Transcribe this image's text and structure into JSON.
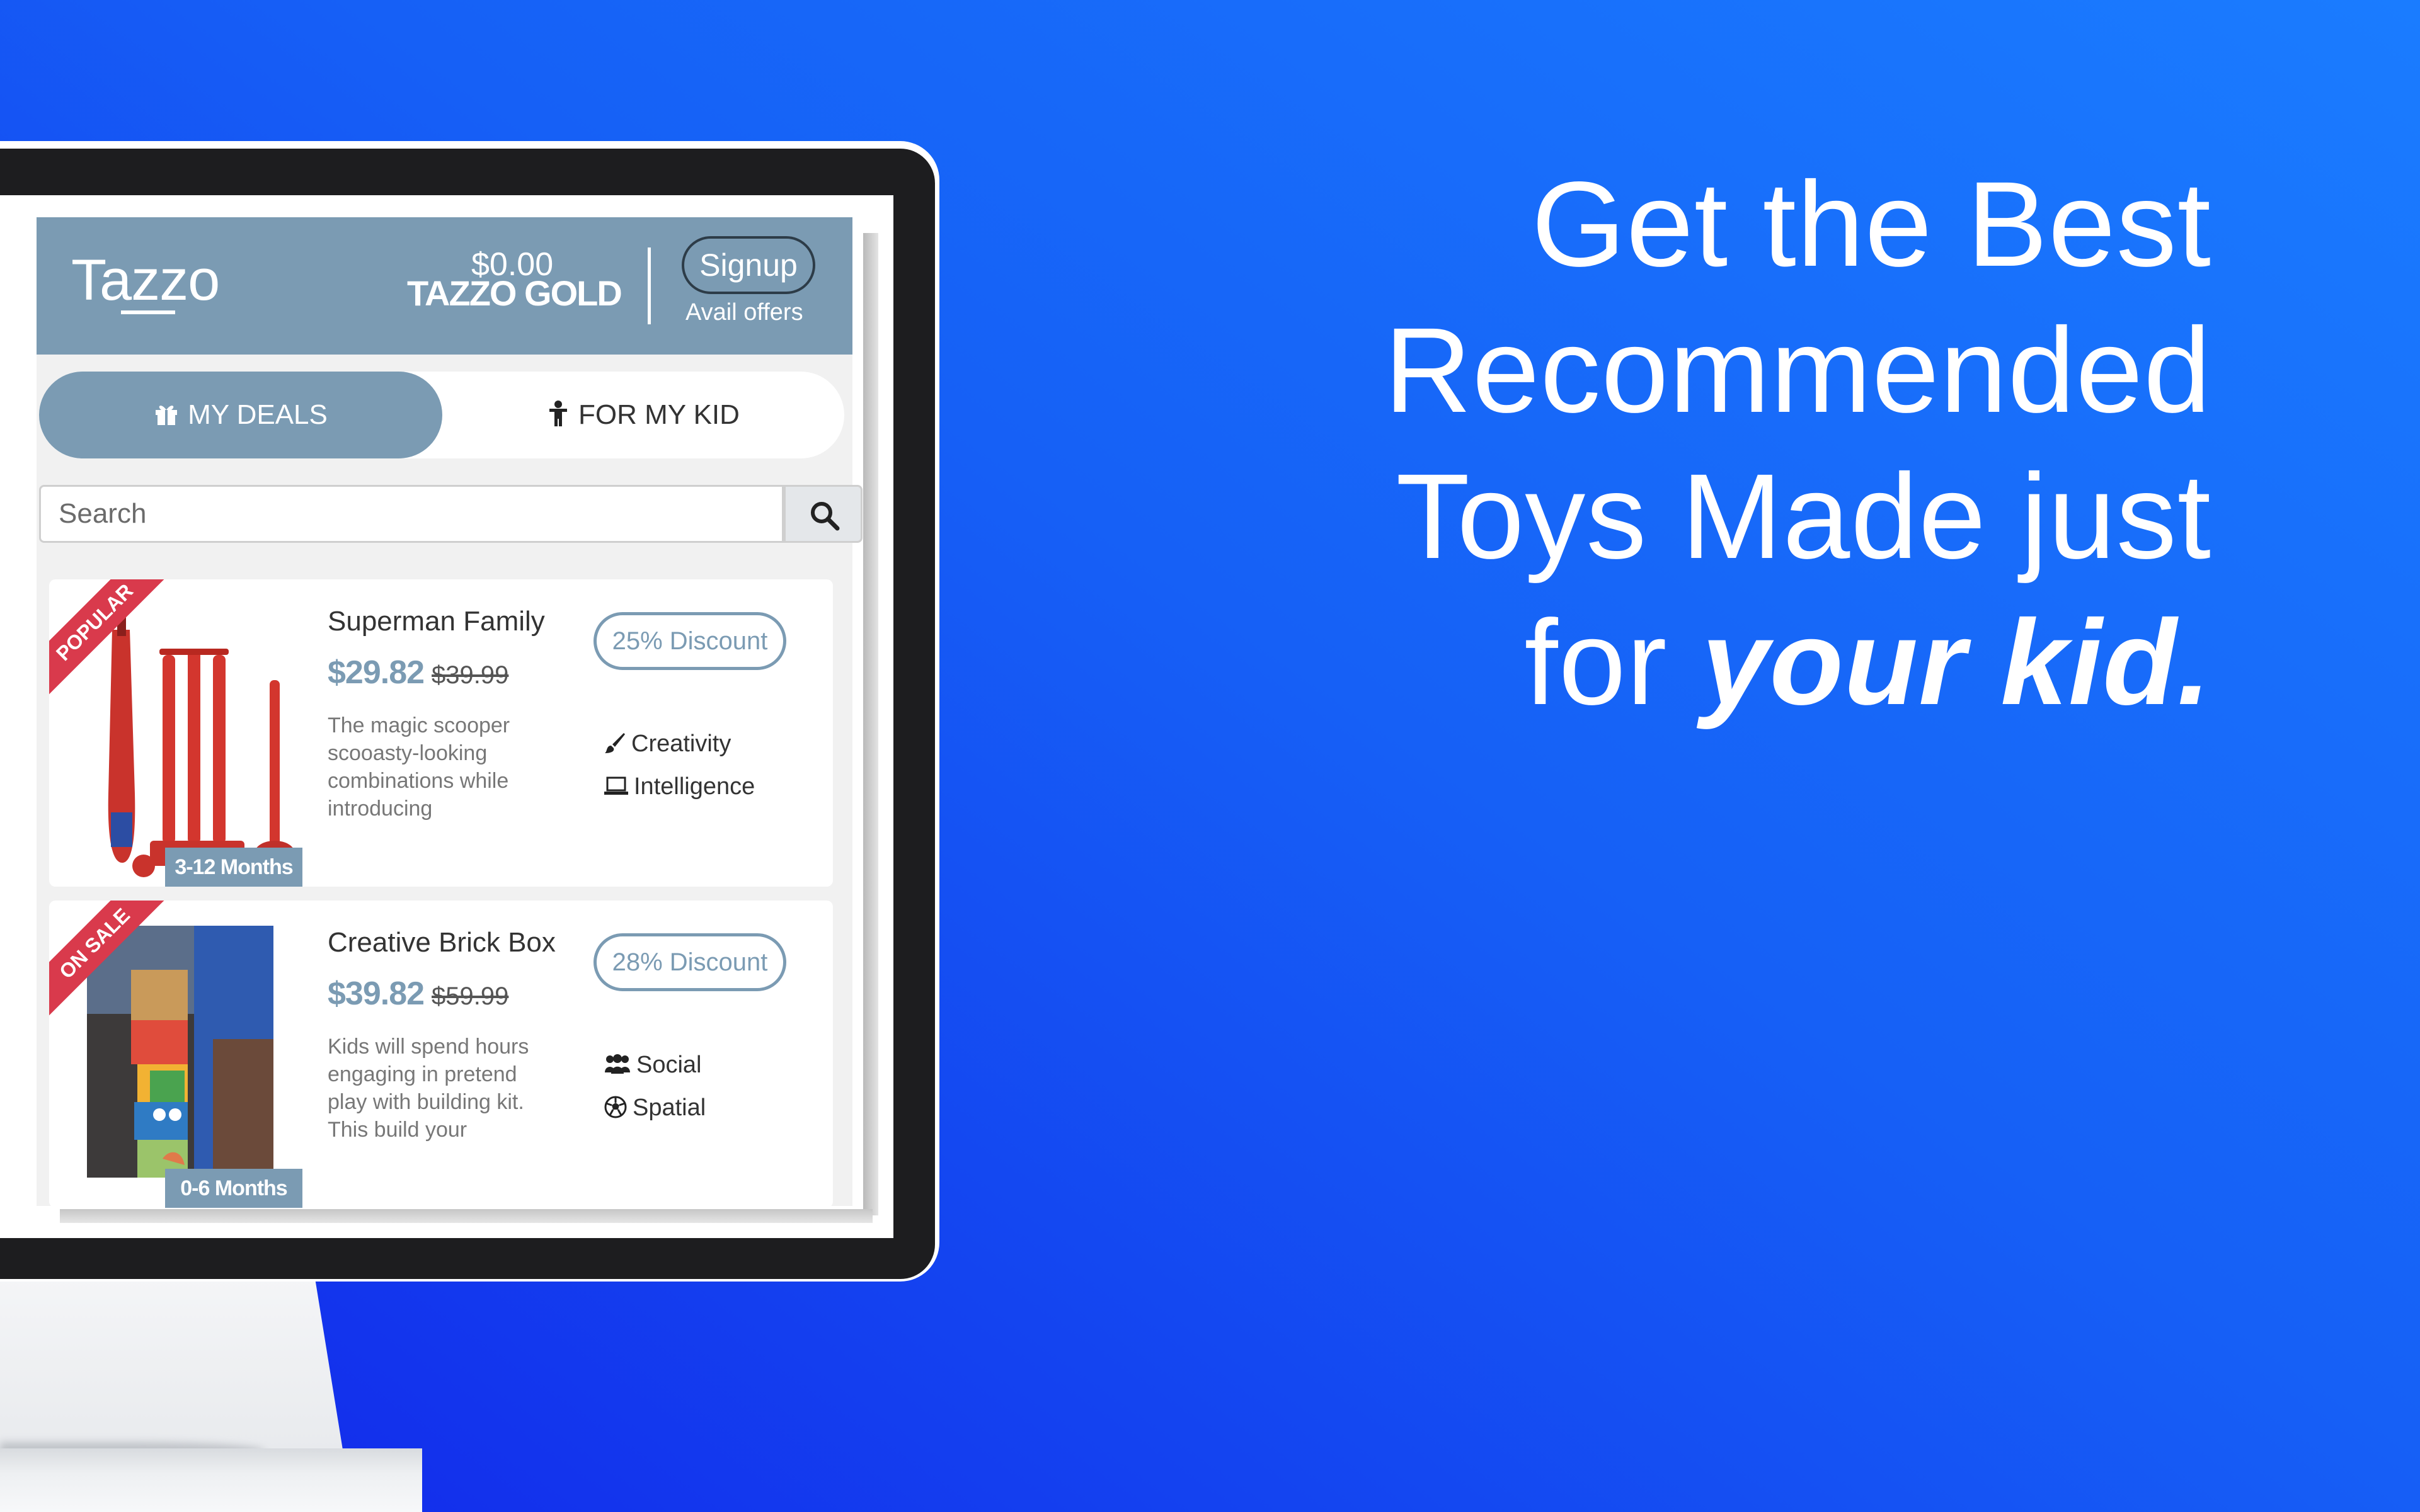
{
  "app": {
    "logo": "Tazzo",
    "wallet_amount": "$0.00",
    "wallet_label": "TAZZO GOLD",
    "signup_label": "Signup",
    "avail_offers": "Avail offers"
  },
  "tabs": [
    {
      "label": "MY DEALS",
      "icon": "gift-icon",
      "active": true
    },
    {
      "label": "FOR MY KID",
      "icon": "child-icon",
      "active": false
    }
  ],
  "search": {
    "placeholder": "Search",
    "icon": "search-icon"
  },
  "products": [
    {
      "ribbon": "POPULAR",
      "title": "Superman Family",
      "price": "$29.82",
      "old_price": "$39.99",
      "description": "The magic scooper scooasty-looking combinations while introducing",
      "discount": "25% Discount",
      "age": "3-12 Months",
      "skills": [
        {
          "label": "Creativity",
          "icon": "brush-icon"
        },
        {
          "label": "Intelligence",
          "icon": "laptop-icon"
        }
      ]
    },
    {
      "ribbon": "ON SALE",
      "title": "Creative Brick Box",
      "price": "$39.82",
      "old_price": "$59.99",
      "description": "Kids will spend hours engaging in pretend play with building kit. This build your",
      "discount": "28% Discount",
      "age": "0-6 Months",
      "skills": [
        {
          "label": "Social",
          "icon": "users-icon"
        },
        {
          "label": "Spatial",
          "icon": "soccer-ball-icon"
        }
      ]
    }
  ],
  "headline": {
    "line1": "Get the Best",
    "line2": "Recommended",
    "line3": "Toys Made just",
    "line4_prefix": "for ",
    "line4_emphasis": "your kid."
  },
  "colors": {
    "background_light": "#1a7cff",
    "background_dark": "#1226ea",
    "app_accent": "#7b9bb3",
    "ribbon": "#d93a4c"
  }
}
